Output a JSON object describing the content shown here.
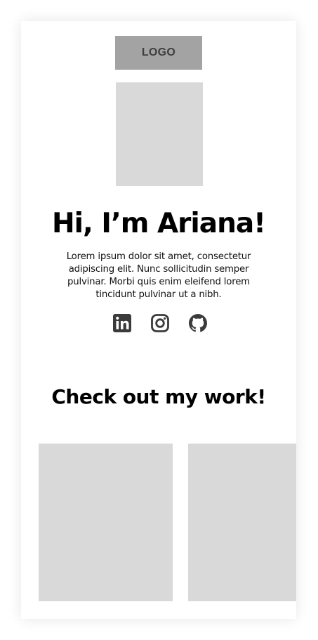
{
  "header": {
    "logo_text": "LOGO"
  },
  "hero": {
    "headline": "Hi, I’m Ariana!",
    "bio": "Lorem ipsum dolor sit amet, consectetur adipiscing elit. Nunc sollicitudin semper pulvinar. Morbi quis enim eleifend lorem tincidunt pulvinar ut a nibh."
  },
  "social": {
    "icons": [
      "linkedin-icon",
      "instagram-icon",
      "github-icon"
    ]
  },
  "work": {
    "heading": "Check out my work!"
  },
  "colors": {
    "placeholder": "#d9d9d9",
    "logo_bg": "#a3a3a3",
    "icon": "#3b3b3b",
    "text": "#000000"
  }
}
